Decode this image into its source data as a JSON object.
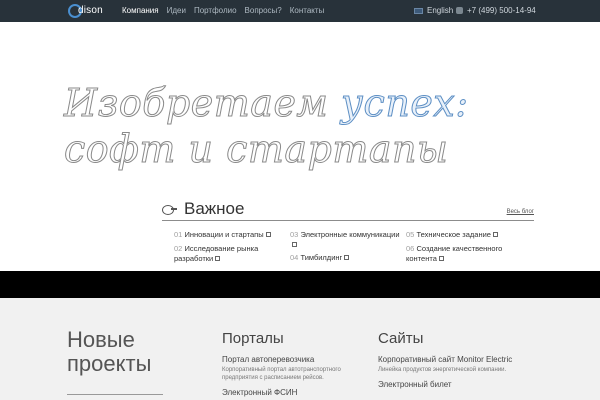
{
  "header": {
    "logo_text": "dison",
    "nav": [
      "Компания",
      "Идеи",
      "Портфолио",
      "Вопросы?",
      "Контакты"
    ],
    "language": "English",
    "phone": "+7 (499) 500-14-94"
  },
  "hero": {
    "line1_part1": "Изобретаем ",
    "line1_accent": "успех:",
    "line2": "софт и стартапы"
  },
  "important": {
    "title": "Важное",
    "blog_link": "Весь блог",
    "items": [
      {
        "num": "01",
        "text": "Инновации и стартапы"
      },
      {
        "num": "02",
        "text": "Исследование рынка разработки"
      },
      {
        "num": "03",
        "text": "Электронные коммуникации"
      },
      {
        "num": "04",
        "text": "Тимбилдинг"
      },
      {
        "num": "05",
        "text": "Техническое задание"
      },
      {
        "num": "06",
        "text": "Создание качественного контента"
      }
    ]
  },
  "bottom": {
    "new_projects_line1": "Новые",
    "new_projects_line2": "проекты",
    "portals": {
      "title": "Порталы",
      "link1": "Портал автоперевозчика",
      "desc1": "Корпоративный портал автотранспортного предприятия с расписанием рейсов.",
      "link2": "Электронный ФСИН"
    },
    "sites": {
      "title": "Сайты",
      "link1": "Корпоративный сайт Monitor Electric",
      "desc1": "Линейка продуктов энергетической компании.",
      "link2": "Электронный билет"
    }
  }
}
